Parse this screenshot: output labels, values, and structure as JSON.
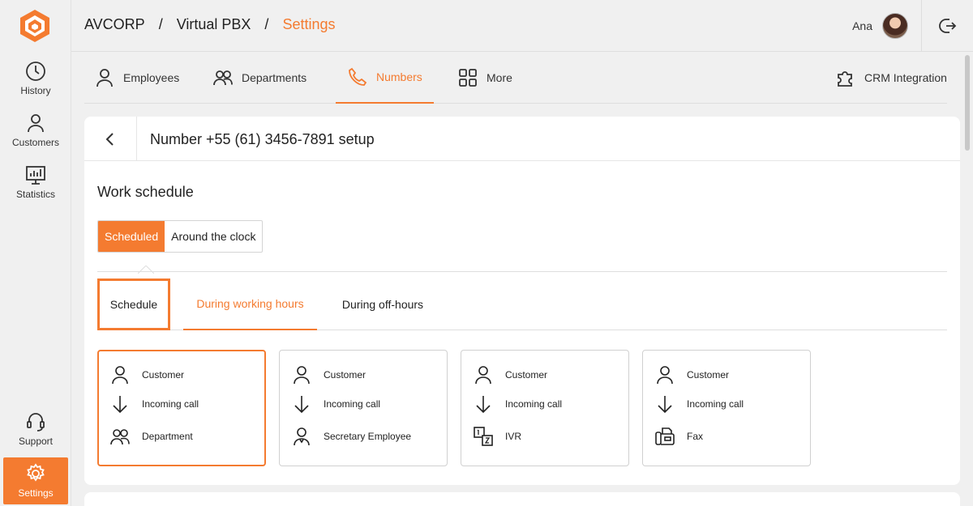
{
  "sidebar": {
    "items": [
      {
        "label": "History",
        "icon": "clock-icon"
      },
      {
        "label": "Customers",
        "icon": "person-icon"
      },
      {
        "label": "Statistics",
        "icon": "chart-icon"
      }
    ],
    "bottom": [
      {
        "label": "Support",
        "icon": "headset-icon"
      },
      {
        "label": "Settings",
        "icon": "gear-icon",
        "active": true
      }
    ]
  },
  "header": {
    "breadcrumb": [
      "AVCORP",
      "Virtual PBX",
      "Settings"
    ],
    "separator": "/",
    "user_name": "Ana"
  },
  "tabs": [
    {
      "label": "Employees",
      "icon": "person-icon"
    },
    {
      "label": "Departments",
      "icon": "people-icon"
    },
    {
      "label": "Numbers",
      "icon": "phone-icon",
      "active": true
    },
    {
      "label": "More",
      "icon": "grid-icon"
    },
    {
      "label": "CRM Integration",
      "icon": "puzzle-icon"
    }
  ],
  "card": {
    "title": "Number +55 (61) 3456-7891 setup",
    "section_title": "Work schedule",
    "segment": {
      "scheduled": "Scheduled",
      "around": "Around the clock",
      "selected": "Scheduled"
    },
    "subtabs": [
      "Schedule",
      "During working hours",
      "During off-hours"
    ],
    "routes": [
      {
        "customer": "Customer",
        "call": "Incoming call",
        "target": "Department",
        "target_icon": "people-icon",
        "selected": true
      },
      {
        "customer": "Customer",
        "call": "Incoming call",
        "target": "Secretary Employee",
        "target_icon": "secretary-icon"
      },
      {
        "customer": "Customer",
        "call": "Incoming call",
        "target": "IVR",
        "target_icon": "ivr-icon"
      },
      {
        "customer": "Customer",
        "call": "Incoming call",
        "target": "Fax",
        "target_icon": "fax-icon"
      }
    ]
  },
  "colors": {
    "accent": "#f47b30",
    "background": "#f0f0f0",
    "card": "#ffffff"
  }
}
